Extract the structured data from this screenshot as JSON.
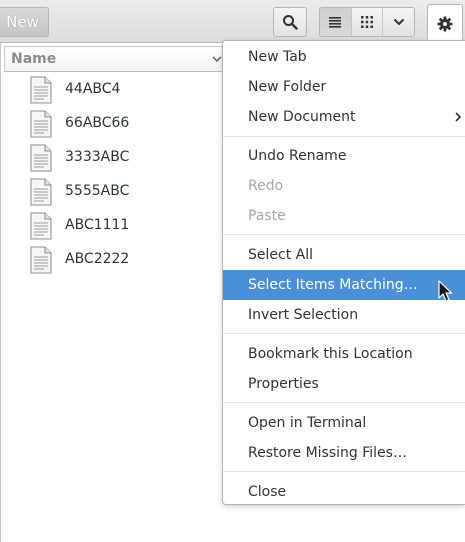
{
  "toolbar": {
    "new_label": "New",
    "search_icon": "search-icon",
    "view_icons": [
      "list-view-icon",
      "grid-view-icon",
      "chevron-down-icon"
    ],
    "gear_icon": "gear-icon"
  },
  "list": {
    "column_header": "Name",
    "files": [
      {
        "name": "44ABC4",
        "icon": "document-icon"
      },
      {
        "name": "66ABC66",
        "icon": "document-icon"
      },
      {
        "name": "3333ABC",
        "icon": "document-icon"
      },
      {
        "name": "5555ABC",
        "icon": "document-icon"
      },
      {
        "name": "ABC1111",
        "icon": "document-icon"
      },
      {
        "name": "ABC2222",
        "icon": "document-icon"
      }
    ]
  },
  "menu": {
    "items": [
      {
        "label": "New Tab",
        "enabled": true
      },
      {
        "label": "New Folder",
        "enabled": true
      },
      {
        "label": "New Document",
        "enabled": true,
        "submenu": true
      },
      {
        "label": "Undo Rename",
        "enabled": true
      },
      {
        "label": "Redo",
        "enabled": false
      },
      {
        "label": "Paste",
        "enabled": false
      },
      {
        "label": "Select All",
        "enabled": true
      },
      {
        "label": "Select Items Matching…",
        "enabled": true,
        "highlighted": true
      },
      {
        "label": "Invert Selection",
        "enabled": true
      },
      {
        "label": "Bookmark this Location",
        "enabled": true
      },
      {
        "label": "Properties",
        "enabled": true
      },
      {
        "label": "Open in Terminal",
        "enabled": true
      },
      {
        "label": "Restore Missing Files…",
        "enabled": true
      },
      {
        "label": "Close",
        "enabled": true
      }
    ]
  },
  "colors": {
    "highlight": "#4a90d9",
    "text": "#2e3436",
    "disabled_text": "#a5a8a6"
  }
}
